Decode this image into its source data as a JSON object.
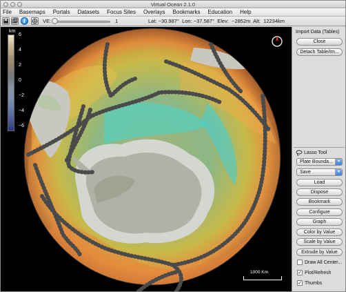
{
  "window": {
    "title": "Virtual Ocean 2.1.0"
  },
  "menu": [
    "File",
    "Basemaps",
    "Portals",
    "Datasets",
    "Focus Sites",
    "Overlays",
    "Bookmarks",
    "Education",
    "Help"
  ],
  "toolbar": {
    "ve_label": "VE:",
    "ve_value": "1",
    "coords": "Lat: −30.987°  Lon: −37.587°  Elev:  −2852m  Alt:  12234km",
    "info_glyph": "i"
  },
  "legend": {
    "unit": "km",
    "ticks": [
      "6",
      "4",
      "2",
      "0",
      "−2",
      "−4",
      "−6"
    ]
  },
  "map": {
    "scale_label": "1000 Km"
  },
  "panel": {
    "import_label": "Import Data (Tables)",
    "close": "Close",
    "detach": "Detach Table/Im...",
    "lasso_label": "Lasso Tool",
    "plate_select": "Plate Bounda...",
    "save_select": "Save",
    "buttons": [
      "Load",
      "Dispose",
      "Bookmark",
      "Configure",
      "Graph",
      "Color by Value",
      "Scale by Value",
      "Extrude by Value"
    ],
    "checkboxes": [
      {
        "label": "Draw All Center...",
        "checked": false
      },
      {
        "label": "Plot/Refresh",
        "checked": true
      },
      {
        "label": "Thumbs",
        "checked": true
      }
    ]
  },
  "colors": {
    "accent": "#3c7fd9",
    "background": "#000000",
    "track": "#4a4a4a"
  }
}
